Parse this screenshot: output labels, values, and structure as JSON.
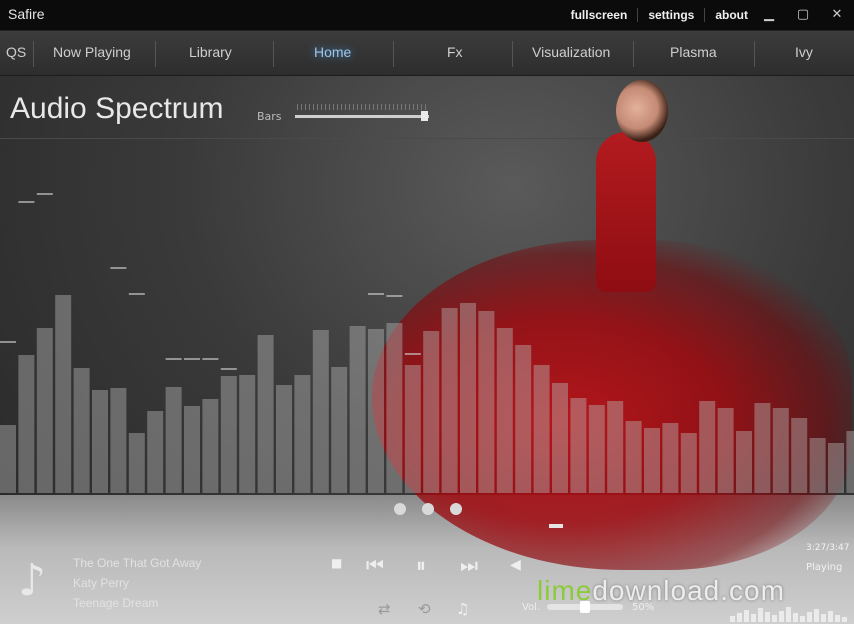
{
  "window": {
    "title": "Safire",
    "links": [
      "fullscreen",
      "settings",
      "about"
    ],
    "controls": {
      "minimize": "▁",
      "maximize": "▢",
      "close": "✕"
    }
  },
  "nav": {
    "items": [
      "QS",
      "Now Playing",
      "Library",
      "Home",
      "Fx",
      "Visualization",
      "Plasma",
      "Ivy"
    ],
    "active": "Home"
  },
  "page": {
    "title": "Audio Spectrum",
    "bars_label": "Bars",
    "bars_slider_level": 0.97
  },
  "spectrum": {
    "bars": [
      68,
      138,
      165,
      198,
      125,
      103,
      105,
      60,
      82,
      106,
      87,
      94,
      117,
      118,
      158,
      108,
      118,
      163,
      126,
      167,
      164,
      170,
      128,
      162,
      185,
      190,
      182,
      165,
      148,
      128,
      110,
      95,
      88,
      92,
      72,
      65,
      70,
      60,
      92,
      85,
      62,
      90,
      85,
      75,
      55,
      50,
      62,
      50,
      45,
      58,
      50,
      40
    ],
    "peaks": [
      152,
      0,
      0,
      0,
      0,
      0,
      0,
      0,
      0,
      0,
      0,
      0,
      0,
      0,
      0,
      0,
      0,
      0,
      0,
      0,
      0,
      200,
      198,
      0,
      0,
      0,
      0,
      0,
      0,
      0,
      0,
      0,
      0,
      0,
      0,
      0,
      0,
      0,
      0,
      0,
      0,
      0,
      0,
      0,
      0,
      0,
      0,
      0,
      0,
      0,
      0,
      0
    ],
    "extra_peaks": [
      {
        "i": 1,
        "v": 292
      },
      {
        "i": 2,
        "v": 300
      },
      {
        "i": 6,
        "v": 226
      },
      {
        "i": 7,
        "v": 200
      },
      {
        "i": 9,
        "v": 135
      },
      {
        "i": 10,
        "v": 135
      },
      {
        "i": 11,
        "v": 135
      },
      {
        "i": 12,
        "v": 125
      },
      {
        "i": 20,
        "v": 200
      },
      {
        "i": 21,
        "v": 198
      },
      {
        "i": 22,
        "v": 140
      },
      {
        "i": 0,
        "v": 152
      }
    ]
  },
  "carousel": {
    "count": 3
  },
  "track": {
    "title": "The One That Got Away",
    "artist": "Katy Perry",
    "album": "Teenage Dream"
  },
  "player": {
    "time": "3:27/3:47",
    "status": "Playing",
    "volume_label": "Vol.",
    "volume_pct": "50%",
    "volume_level": 0.5
  },
  "icons": {
    "note": "music-note-icon",
    "stop": "stop-icon",
    "prev": "previous-icon",
    "pause": "pause-icon",
    "next": "next-icon",
    "mute": "speaker-icon",
    "shuffle": "shuffle-icon",
    "repeat": "repeat-icon",
    "playlist": "music-note-icon"
  },
  "watermark": {
    "part1": "lime",
    "part2": "download.com"
  },
  "colors": {
    "accent_blue": "#4a8fd0",
    "watermark_green": "#8bcb3b",
    "dress_red": "#b31b1f"
  }
}
